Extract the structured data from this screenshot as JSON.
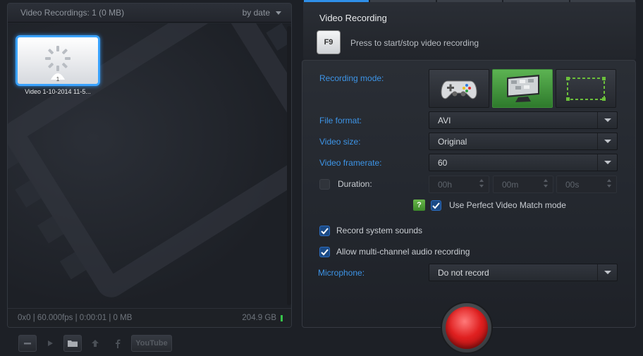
{
  "left": {
    "header_title": "Video Recordings: 1 (0 MB)",
    "sort_label": "by date",
    "thumbnail": {
      "label": "Video 1-10-2014 11-5...",
      "badge": "1"
    },
    "footer_info": "0x0 | 60.000fps | 0:00:01 | 0 MB",
    "disk_free": "204.9 GB"
  },
  "toolbar": {
    "youtube_label": "YouTube"
  },
  "right": {
    "title": "Video Recording",
    "hotkey": "F9",
    "hotkey_hint": "Press to start/stop video recording",
    "recording_mode_label": "Recording mode:",
    "file_format_label": "File format:",
    "file_format_value": "AVI",
    "video_size_label": "Video size:",
    "video_size_value": "Original",
    "video_framerate_label": "Video framerate:",
    "video_framerate_value": "60",
    "duration_label": "Duration:",
    "duration_hours": "00h",
    "duration_minutes": "00m",
    "duration_seconds": "00s",
    "help_glyph": "?",
    "perfect_match_label": "Use Perfect Video Match mode",
    "system_sounds_label": "Record system sounds",
    "multichannel_label": "Allow multi-channel audio recording",
    "microphone_label": "Microphone:",
    "microphone_value": "Do not record"
  },
  "colors": {
    "accent_blue": "#3d94e6",
    "record_red": "#e02020",
    "active_green": "#4ea546"
  }
}
